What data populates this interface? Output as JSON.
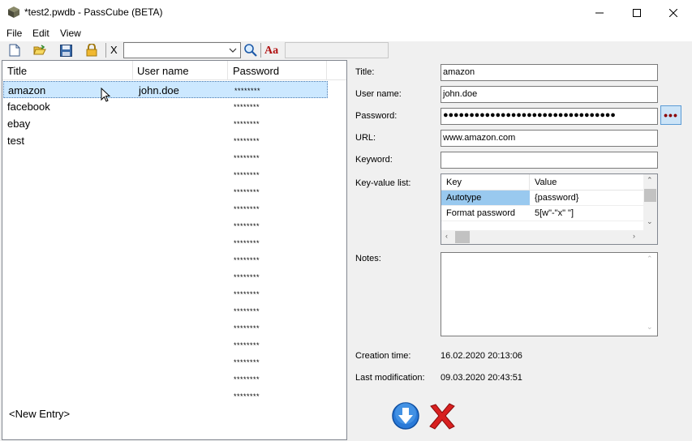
{
  "window": {
    "title": "*test2.pwdb - PassCube (BETA)",
    "icon": "app-cube-icon"
  },
  "menu": {
    "file": "File",
    "edit": "Edit",
    "view": "View"
  },
  "toolbar": {
    "icons": [
      "new-file-icon",
      "open-folder-icon",
      "save-disk-icon",
      "lock-icon"
    ],
    "clear_label": "X",
    "search_value": "",
    "search_icon": "magnifier-icon",
    "match_case_label": "Aa",
    "filter_value": ""
  },
  "list": {
    "columns": [
      "Title",
      "User name",
      "Password"
    ],
    "rows": [
      {
        "title": "amazon",
        "user": "john.doe",
        "password": "********"
      },
      {
        "title": "facebook",
        "user": "",
        "password": "********"
      },
      {
        "title": "ebay",
        "user": "",
        "password": "********"
      },
      {
        "title": "test",
        "user": "",
        "password": "********"
      },
      {
        "title": "",
        "user": "",
        "password": "********"
      },
      {
        "title": "",
        "user": "",
        "password": "********"
      },
      {
        "title": "",
        "user": "",
        "password": "********"
      },
      {
        "title": "",
        "user": "",
        "password": "********"
      },
      {
        "title": "",
        "user": "",
        "password": "********"
      },
      {
        "title": "",
        "user": "",
        "password": "********"
      },
      {
        "title": "",
        "user": "",
        "password": "********"
      },
      {
        "title": "",
        "user": "",
        "password": "********"
      },
      {
        "title": "",
        "user": "",
        "password": "********"
      },
      {
        "title": "",
        "user": "",
        "password": "********"
      },
      {
        "title": "",
        "user": "",
        "password": "********"
      },
      {
        "title": "",
        "user": "",
        "password": "********"
      },
      {
        "title": "",
        "user": "",
        "password": "********"
      },
      {
        "title": "",
        "user": "",
        "password": "********"
      },
      {
        "title": "",
        "user": "",
        "password": "********"
      }
    ],
    "new_entry": "<New Entry>"
  },
  "detail": {
    "title_label": "Title:",
    "title_value": "amazon",
    "user_label": "User name:",
    "user_value": "john.doe",
    "password_label": "Password:",
    "password_value": "●●●●●●●●●●●●●●●●●●●●●●●●●●●●●●●●●",
    "password_button": "•••",
    "url_label": "URL:",
    "url_value": "www.amazon.com",
    "keyword_label": "Keyword:",
    "keyword_value": "",
    "kv_label": "Key-value list:",
    "kv_columns": [
      "Key",
      "Value"
    ],
    "kv_rows": [
      {
        "key": "Autotype",
        "value": "{password}"
      },
      {
        "key": "Format password",
        "value": "5[w\"-\"x\" \"]"
      }
    ],
    "notes_label": "Notes:",
    "notes_value": "",
    "creation_label": "Creation time:",
    "creation_value": "16.02.2020 20:13:06",
    "modified_label": "Last modification:",
    "modified_value": "09.03.2020 20:43:51",
    "save_icon": "download-arrow-icon",
    "cancel_icon": "red-x-icon"
  },
  "colors": {
    "selection": "#cce8ff",
    "kv_selection": "#99c9ef",
    "accent_blue": "#1e6fd0",
    "cancel_red": "#d01818"
  }
}
